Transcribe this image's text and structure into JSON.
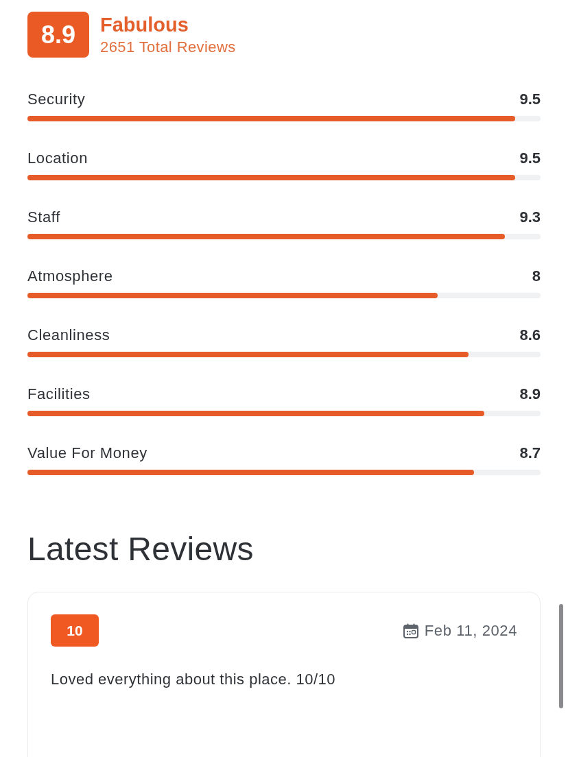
{
  "rating": {
    "score": "8.9",
    "verdict": "Fabulous",
    "total_reviews": "2651 Total Reviews"
  },
  "categories": [
    {
      "name": "Security",
      "score": "9.5",
      "level": 0.95
    },
    {
      "name": "Location",
      "score": "9.5",
      "level": 0.95
    },
    {
      "name": "Staff",
      "score": "9.3",
      "level": 0.93
    },
    {
      "name": "Atmosphere",
      "score": "8",
      "level": 0.8
    },
    {
      "name": "Cleanliness",
      "score": "8.6",
      "level": 0.86
    },
    {
      "name": "Facilities",
      "score": "8.9",
      "level": 0.89
    },
    {
      "name": "Value For Money",
      "score": "8.7",
      "level": 0.87
    }
  ],
  "latest_reviews": {
    "title": "Latest Reviews",
    "reviews": [
      {
        "score": "10",
        "date": "Feb 11, 2024",
        "text": "Loved everything about this place. 10/10"
      }
    ]
  }
}
